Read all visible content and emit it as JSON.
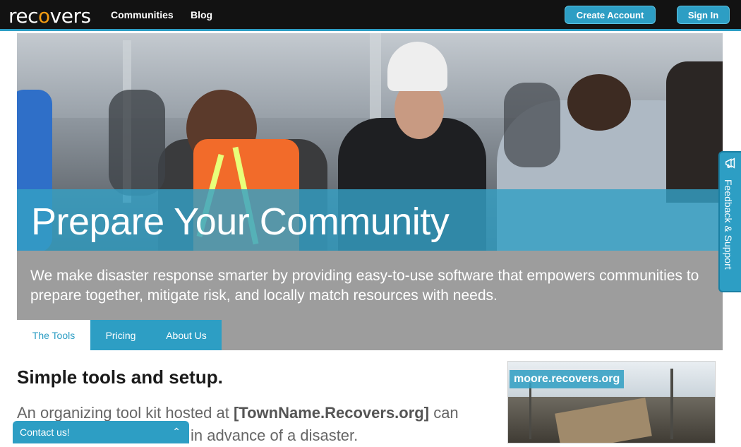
{
  "nav": {
    "logo_prefix": "rec",
    "logo_o": "o",
    "logo_suffix": "vers",
    "links": [
      "Communities",
      "Blog"
    ],
    "create_account": "Create Account",
    "sign_in": "Sign In"
  },
  "hero": {
    "title": "Prepare Your Community",
    "subtitle": "We make disaster response smarter by providing easy-to-use software that empowers communities to prepare together, mitigate risk, and locally match resources with needs.",
    "tabs": [
      "The Tools",
      "Pricing",
      "About Us"
    ]
  },
  "content": {
    "title": "Simple tools and setup.",
    "text_before": "An organizing tool kit hosted at ",
    "text_bold": "[TownName.Recovers.org]",
    "text_after": " can … in advance of a disaster.",
    "visible_line1_end": " can",
    "visible_line2": "in advance of a disaster.",
    "thumbnail_label": "moore.recovers.org"
  },
  "feedback": {
    "label": "Feedback & Support",
    "icon": "megaphone-icon"
  },
  "contact": {
    "label": "Contact us!",
    "icon": "chevron-up-icon"
  },
  "colors": {
    "accent": "#2d9ec4",
    "nav_bg": "#121212",
    "brand_o": "#f39c12"
  }
}
